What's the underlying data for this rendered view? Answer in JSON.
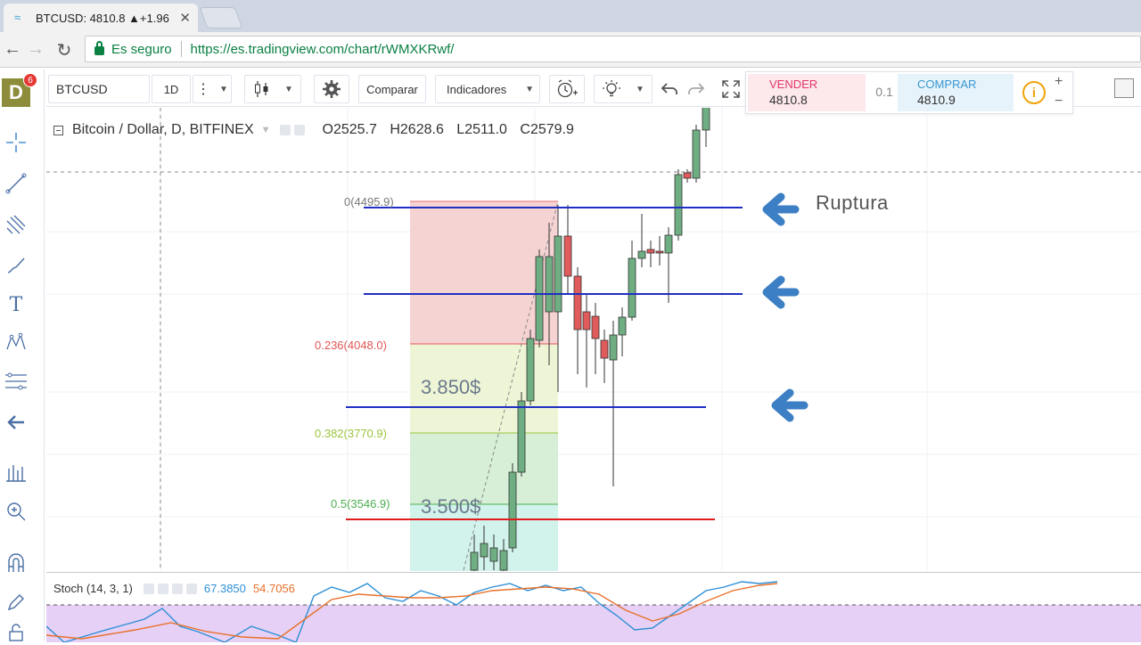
{
  "browser": {
    "tab_title": "BTCUSD: 4810.8 ▲+1.96",
    "secure_label": "Es seguro",
    "url": "https://es.tradingview.com/chart/rWMXKRwf/"
  },
  "user": {
    "avatar_letter": "D",
    "notification_count": "6"
  },
  "toolbar": {
    "symbol": "BTCUSD",
    "interval": "1D",
    "compare_label": "Comparar",
    "indicators_label": "Indicadores"
  },
  "order_panel": {
    "sell_label": "VENDER",
    "sell_price": "4810.8",
    "spread": "0.1",
    "buy_label": "COMPRAR",
    "buy_price": "4810.9",
    "plus": "+",
    "minus": "−"
  },
  "legend": {
    "title": "Bitcoin / Dollar, D, BITFINEX",
    "open": "O2525.7",
    "high": "H2628.6",
    "low": "L2511.0",
    "close": "C2579.9"
  },
  "fibonacci": [
    {
      "label": "0(4495.9)",
      "level": 0,
      "price": 4495.9,
      "color": "#e57373"
    },
    {
      "label": "0.236(4048.0)",
      "level": 0.236,
      "price": 4048.0,
      "color": "#e15656"
    },
    {
      "label": "0.382(3770.9)",
      "level": 0.382,
      "price": 3770.9,
      "color": "#9bc53d"
    },
    {
      "label": "0.5(3546.9)",
      "level": 0.5,
      "price": 3546.9,
      "color": "#4caf50"
    }
  ],
  "annotations": {
    "breakout": "Ruptura",
    "level_high": "3.850$",
    "level_low": "3.500$"
  },
  "stochastic": {
    "label": "Stoch (14, 3, 1)",
    "k_value": "67.3850",
    "d_value": "54.7056"
  },
  "colors": {
    "up_candle": "#6fad82",
    "down_candle": "#e05b5b",
    "support_line": "#1f2fc2",
    "red_line": "#e21b1b",
    "arrow": "#3d7fc4"
  }
}
